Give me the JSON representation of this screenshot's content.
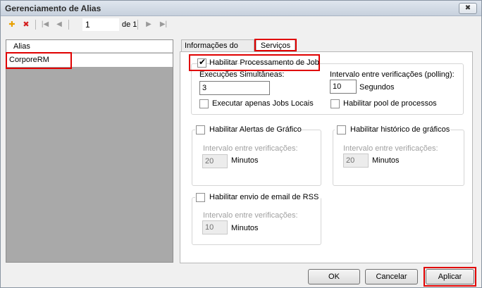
{
  "window": {
    "title": "Gerenciamento de Alias",
    "close_glyph": "✖"
  },
  "toolbar": {
    "add_glyph": "✚",
    "delete_glyph": "✖",
    "first_glyph": "|◀",
    "prev_glyph": "◀",
    "next_glyph": "▶",
    "last_glyph": "▶|",
    "page_value": "1",
    "page_of": "de 1"
  },
  "alias_list": {
    "header": "Alias",
    "items": [
      "CorporeRM"
    ]
  },
  "tabs": {
    "info": "Informações do Alias",
    "services": "Serviços"
  },
  "services": {
    "job_processing": {
      "label": "Habilitar Processamento de Job",
      "checked": true
    },
    "simultaneous_label": "Execuções Simultâneas:",
    "simultaneous_value": "3",
    "polling_label": "Intervalo entre verificações (polling):",
    "polling_value": "10",
    "polling_unit": "Segundos",
    "local_jobs_label": "Executar apenas Jobs Locais",
    "process_pool_label": "Habilitar pool de processos",
    "chart_alerts": {
      "label": "Habilitar Alertas de Gráfico",
      "interval_label": "Intervalo entre verificações:",
      "value": "20",
      "unit": "Minutos"
    },
    "chart_history": {
      "label": "Habilitar histórico de gráficos",
      "interval_label": "Intervalo entre verificações:",
      "value": "20",
      "unit": "Minutos"
    },
    "rss_email": {
      "label": "Habilitar envio de email de RSS",
      "interval_label": "Intervalo entre verificações:",
      "value": "10",
      "unit": "Minutos"
    }
  },
  "buttons": {
    "ok": "OK",
    "cancel": "Cancelar",
    "apply": "Aplicar"
  },
  "colors": {
    "highlight": "#e00000",
    "add_icon": "#e8a000",
    "delete_icon": "#d42020"
  }
}
